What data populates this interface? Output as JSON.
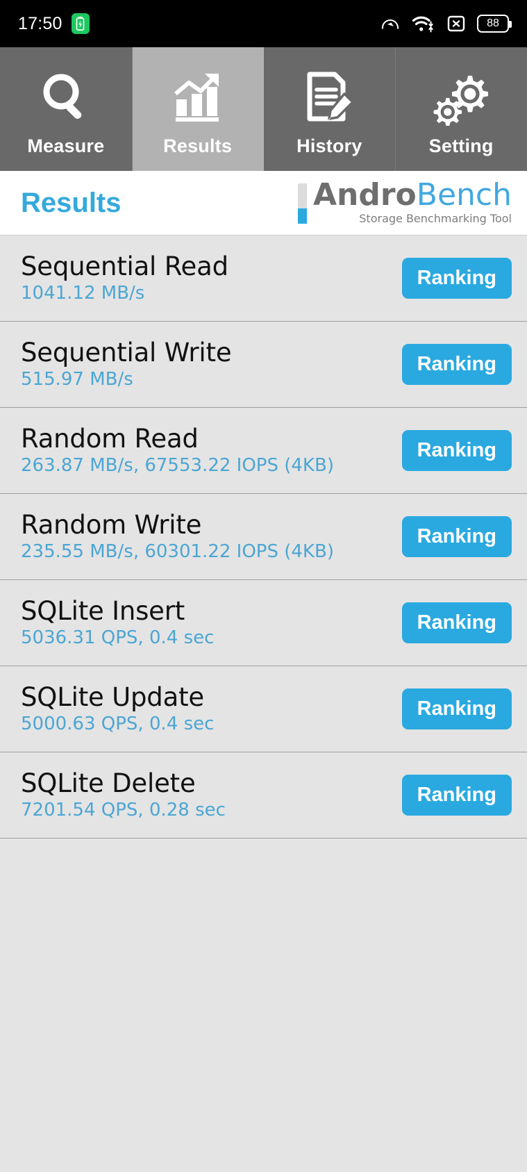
{
  "statusbar": {
    "time": "17:50",
    "battery_chip_icon": "battery-charging-icon",
    "data_saver_icon": "speedometer-icon",
    "wifi_icon": "wifi-icon",
    "no_sim_icon": "x-in-box-icon",
    "battery_level": "88"
  },
  "tabs": [
    {
      "label": "Measure",
      "icon": "magnifier-icon",
      "active": false
    },
    {
      "label": "Results",
      "icon": "bar-chart-arrow-icon",
      "active": true
    },
    {
      "label": "History",
      "icon": "document-pencil-icon",
      "active": false
    },
    {
      "label": "Setting",
      "icon": "gears-icon",
      "active": false
    }
  ],
  "header": {
    "title": "Results",
    "brand_primary": "Andro",
    "brand_secondary": "Bench",
    "brand_subtitle": "Storage Benchmarking Tool"
  },
  "colors": {
    "accent_blue": "#2aa9e0",
    "value_blue": "#4ba6d4",
    "tab_inactive": "#696969",
    "tab_active": "#b2b2b2",
    "list_bg": "#e4e4e4"
  },
  "results": [
    {
      "name": "Sequential Read",
      "value": "1041.12 MB/s",
      "button": "Ranking"
    },
    {
      "name": "Sequential Write",
      "value": "515.97 MB/s",
      "button": "Ranking"
    },
    {
      "name": "Random Read",
      "value": "263.87 MB/s, 67553.22 IOPS (4KB)",
      "button": "Ranking"
    },
    {
      "name": "Random Write",
      "value": "235.55 MB/s, 60301.22 IOPS (4KB)",
      "button": "Ranking"
    },
    {
      "name": "SQLite Insert",
      "value": "5036.31 QPS, 0.4 sec",
      "button": "Ranking"
    },
    {
      "name": "SQLite Update",
      "value": "5000.63 QPS, 0.4 sec",
      "button": "Ranking"
    },
    {
      "name": "SQLite Delete",
      "value": "7201.54 QPS, 0.28 sec",
      "button": "Ranking"
    }
  ]
}
